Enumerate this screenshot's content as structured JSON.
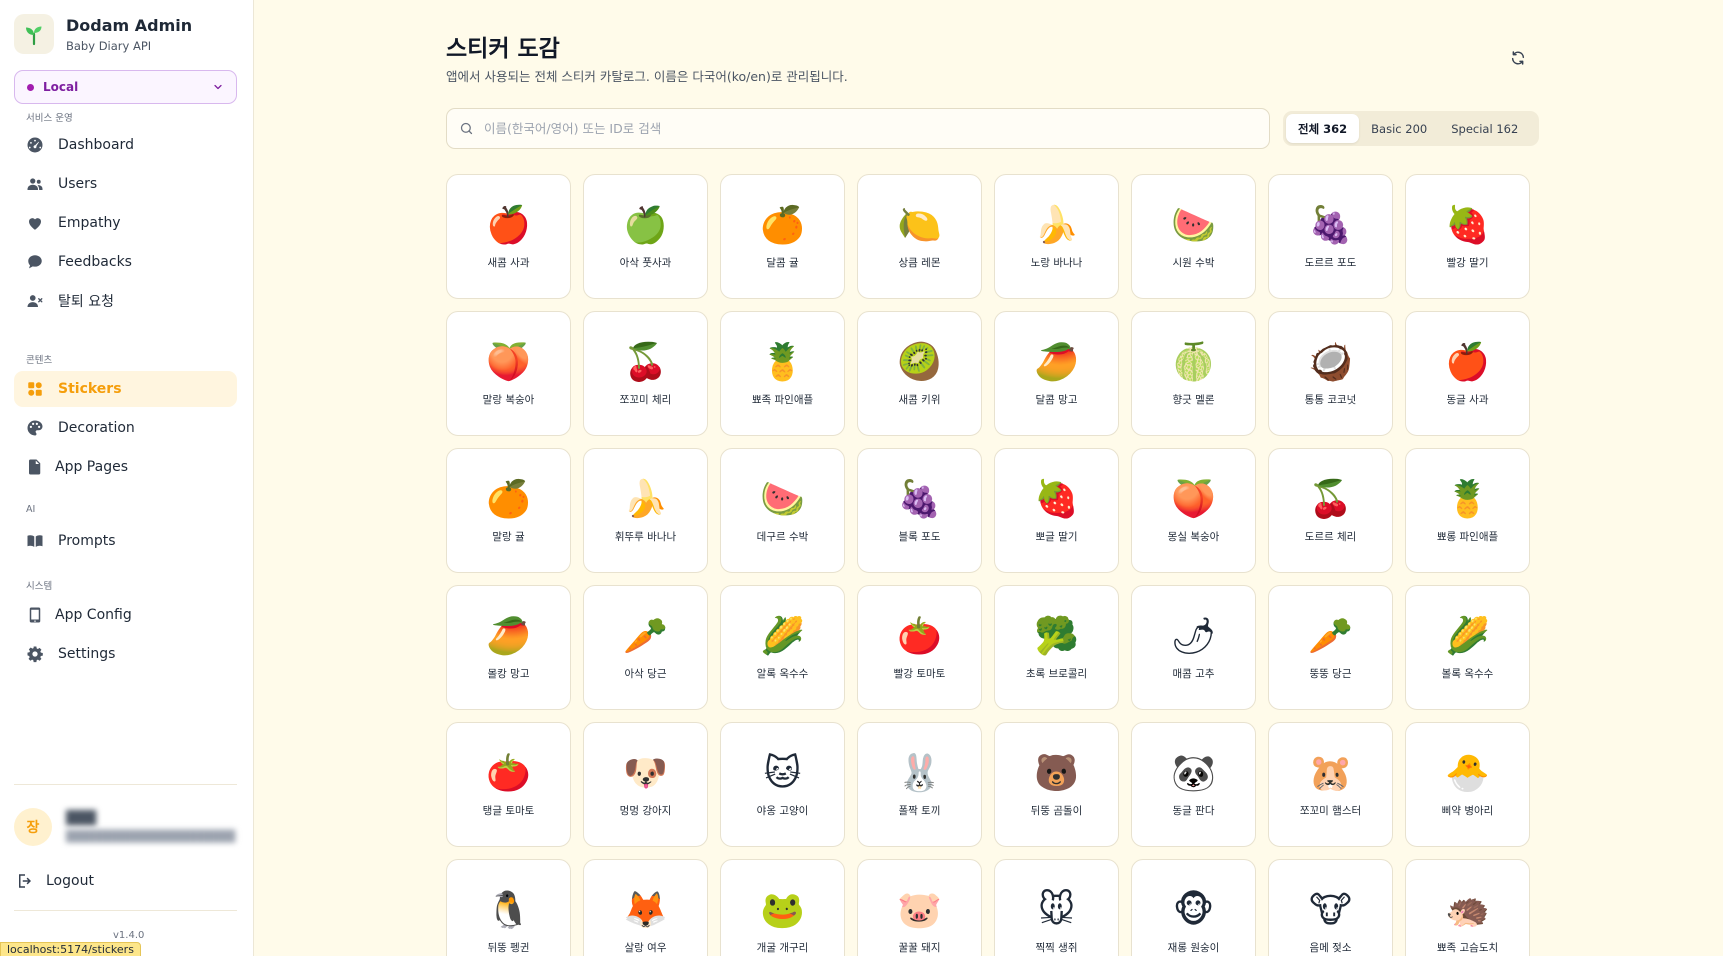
{
  "app": {
    "title": "Dodam Admin",
    "subtitle": "Baby Diary API",
    "env": "Local"
  },
  "sidebar": {
    "sections": [
      {
        "label": "서비스 운영",
        "items": [
          {
            "label": "Dashboard",
            "icon": "dashboard-icon"
          },
          {
            "label": "Users",
            "icon": "users-icon"
          },
          {
            "label": "Empathy",
            "icon": "heart-icon"
          },
          {
            "label": "Feedbacks",
            "icon": "comment-icon"
          },
          {
            "label": "탈퇴 요청",
            "icon": "user-remove-icon"
          }
        ]
      },
      {
        "label": "콘텐츠",
        "items": [
          {
            "label": "Stickers",
            "icon": "sticker-icon",
            "active": true
          },
          {
            "label": "Decoration",
            "icon": "palette-icon"
          },
          {
            "label": "App Pages",
            "icon": "file-icon"
          }
        ]
      },
      {
        "label": "AI",
        "items": [
          {
            "label": "Prompts",
            "icon": "book-icon"
          }
        ]
      },
      {
        "label": "시스템",
        "items": [
          {
            "label": "App Config",
            "icon": "phone-icon"
          },
          {
            "label": "Settings",
            "icon": "gear-icon"
          }
        ]
      }
    ],
    "user": {
      "avatar": "장",
      "name": "███",
      "email": "████████████████████"
    },
    "logout": "Logout",
    "version": "v1.4.0"
  },
  "status_url": "localhost:5174/stickers",
  "main": {
    "title": "스티커 도감",
    "description": "앱에서 사용되는 전체 스티커 카탈로그. 이름은 다국어(ko/en)로 관리됩니다.",
    "search_placeholder": "이름(한국어/영어) 또는 ID로 검색",
    "filters": [
      {
        "label": "전체 362",
        "active": true
      },
      {
        "label": "Basic 200",
        "active": false
      },
      {
        "label": "Special 162",
        "active": false
      }
    ],
    "stickers": [
      {
        "name": "새콤 사과",
        "glyph": "🍎"
      },
      {
        "name": "아삭 풋사과",
        "glyph": "🍏"
      },
      {
        "name": "달콤 귤",
        "glyph": "🍊"
      },
      {
        "name": "상큼 레몬",
        "glyph": "🍋"
      },
      {
        "name": "노랑 바나나",
        "glyph": "🍌"
      },
      {
        "name": "시원 수박",
        "glyph": "🍉"
      },
      {
        "name": "도르르 포도",
        "glyph": "🍇"
      },
      {
        "name": "빨강 딸기",
        "glyph": "🍓"
      },
      {
        "name": "말랑 복숭아",
        "glyph": "🍑"
      },
      {
        "name": "쪼꼬미 체리",
        "glyph": "🍒"
      },
      {
        "name": "뾰족 파인애플",
        "glyph": "🍍"
      },
      {
        "name": "새콤 키위",
        "glyph": "🥝"
      },
      {
        "name": "달콤 망고",
        "glyph": "🥭"
      },
      {
        "name": "향긋 멜론",
        "glyph": "🍈"
      },
      {
        "name": "통통 코코넛",
        "glyph": "🥥"
      },
      {
        "name": "동글 사과",
        "glyph": "🍎"
      },
      {
        "name": "말랑 귤",
        "glyph": "🍊"
      },
      {
        "name": "휘뚜루 바나나",
        "glyph": "🍌"
      },
      {
        "name": "데구르 수박",
        "glyph": "🍉"
      },
      {
        "name": "블록 포도",
        "glyph": "🍇"
      },
      {
        "name": "뽀글 딸기",
        "glyph": "🍓"
      },
      {
        "name": "몽실 복숭아",
        "glyph": "🍑"
      },
      {
        "name": "도르르 체리",
        "glyph": "🍒"
      },
      {
        "name": "뾰롱 파인애플",
        "glyph": "🍍"
      },
      {
        "name": "몰캉 망고",
        "glyph": "🥭"
      },
      {
        "name": "아삭 당근",
        "glyph": "🥕"
      },
      {
        "name": "알록 옥수수",
        "glyph": "🌽"
      },
      {
        "name": "빨강 토마토",
        "glyph": "🍅"
      },
      {
        "name": "초록 브로콜리",
        "glyph": "🥦"
      },
      {
        "name": "매콤 고추",
        "glyph": "🌶"
      },
      {
        "name": "뚱뚱 당근",
        "glyph": "🥕"
      },
      {
        "name": "볼록 옥수수",
        "glyph": "🌽"
      },
      {
        "name": "탱글 토마토",
        "glyph": "🍅"
      },
      {
        "name": "멍멍 강아지",
        "glyph": "🐶"
      },
      {
        "name": "야옹 고양이",
        "glyph": "🐱"
      },
      {
        "name": "폴짝 토끼",
        "glyph": "🐰"
      },
      {
        "name": "뒤뚱 곰돌이",
        "glyph": "🐻"
      },
      {
        "name": "동글 판다",
        "glyph": "🐼"
      },
      {
        "name": "쪼꼬미 햄스터",
        "glyph": "🐹"
      },
      {
        "name": "삐약 병아리",
        "glyph": "🐣"
      },
      {
        "name": "뒤뚱 펭귄",
        "glyph": "🐧"
      },
      {
        "name": "살랑 여우",
        "glyph": "🦊"
      },
      {
        "name": "개굴 개구리",
        "glyph": "🐸"
      },
      {
        "name": "꿀꿀 돼지",
        "glyph": "🐷"
      },
      {
        "name": "찍찍 생쥐",
        "glyph": "🐭"
      },
      {
        "name": "재롱 원숭이",
        "glyph": "🐵"
      },
      {
        "name": "음메 젖소",
        "glyph": "🐮"
      },
      {
        "name": "뾰족 고슴도치",
        "glyph": "🦔"
      }
    ]
  }
}
